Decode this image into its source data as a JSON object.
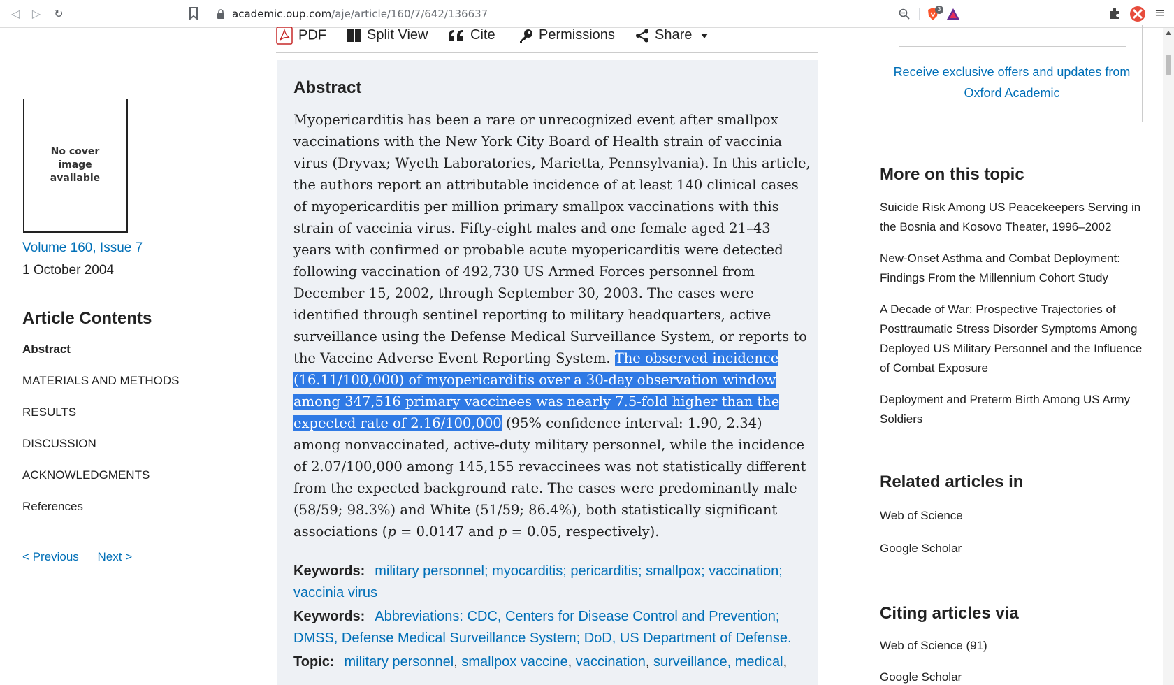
{
  "browser": {
    "url_host": "academic.oup.com",
    "url_path": "/aje/article/160/7/642/136637",
    "brave_shield_count": "3"
  },
  "sidebar": {
    "cover_text": "No cover image available",
    "volume_link": "Volume 160, Issue 7",
    "issue_date": "1 October 2004",
    "contents_heading": "Article Contents",
    "toc": [
      "Abstract",
      "MATERIALS AND METHODS",
      "RESULTS",
      "DISCUSSION",
      "ACKNOWLEDGMENTS",
      "References"
    ],
    "previous": "< Previous",
    "next": "Next >"
  },
  "toolbar": {
    "pdf": "PDF",
    "split_view": "Split View",
    "cite": "Cite",
    "permissions": "Permissions",
    "share": "Share"
  },
  "abstract": {
    "heading": "Abstract",
    "before_highlight": "Myopericarditis has been a rare or unrecognized event after smallpox vaccinations with the New York City Board of Health strain of vaccinia virus (Dryvax; Wyeth Laboratories, Marietta, Pennsylvania). In this article, the authors report an attributable incidence of at least 140 clinical cases of myopericarditis per million primary smallpox vaccinations with this strain of vaccinia virus. Fifty-eight males and one female aged 21–43 years with confirmed or probable acute myopericarditis were detected following vaccination of 492,730 US Armed Forces personnel from December 15, 2002, through September 30, 2003. The cases were identified through sentinel reporting to military headquarters, active surveillance using the Defense Medical Surveillance System, or reports to the Vaccine Adverse Event Reporting System. ",
    "highlighted": "The observed incidence (16.11/100,000) of myopericarditis over a 30-day observation window among 347,516 primary vaccinees was nearly 7.5-fold higher than the expected rate of 2.16/100,000",
    "after_highlight_1": " (95% confidence interval: 1.90, 2.34) among nonvaccinated, active-duty military personnel, while the incidence of 2.07/100,000 among 145,155 revaccinees was not statistically different from the expected background rate. The cases were predominantly male (58/59; 98.3%) and White (51/59; 86.4%), both statistically significant associations (",
    "p1": "p",
    "mid_p": " = 0.0147 and ",
    "p2": "p",
    "after_p": " = 0.05, respectively)."
  },
  "keywords": {
    "label": "Keywords:",
    "terms": "military personnel; myocarditis; pericarditis; smallpox; vaccination; vaccinia virus",
    "label2": "Keywords:",
    "abbreviations": "Abbreviations: CDC, Centers for Disease Control and Prevention; DMSS, Defense Medical Surveillance System; DoD, US Department of Defense.",
    "topic_label": "Topic:",
    "topics": [
      "military personnel",
      "smallpox vaccine",
      "vaccination",
      "surveillance, medical"
    ]
  },
  "right": {
    "offer": "Receive exclusive offers and updates from Oxford Academic",
    "more_heading": "More on this topic",
    "more_items": [
      "Suicide Risk Among US Peacekeepers Serving in the Bosnia and Kosovo Theater, 1996–2002",
      "New-Onset Asthma and Combat Deployment: Findings From the Millennium Cohort Study",
      "A Decade of War: Prospective Trajectories of Posttraumatic Stress Disorder Symptoms Among Deployed US Military Personnel and the Influence of Combat Exposure",
      "Deployment and Preterm Birth Among US Army Soldiers"
    ],
    "related_heading": "Related articles in",
    "related_wos": "Web of Science",
    "related_gs": "Google Scholar",
    "citing_heading": "Citing articles via",
    "citing_wos": "Web of Science (91)",
    "citing_gs": "Google Scholar"
  },
  "colors": {
    "link": "#006fb7",
    "highlight": "#2f7ae5",
    "abstract_bg": "#eef1f5"
  }
}
